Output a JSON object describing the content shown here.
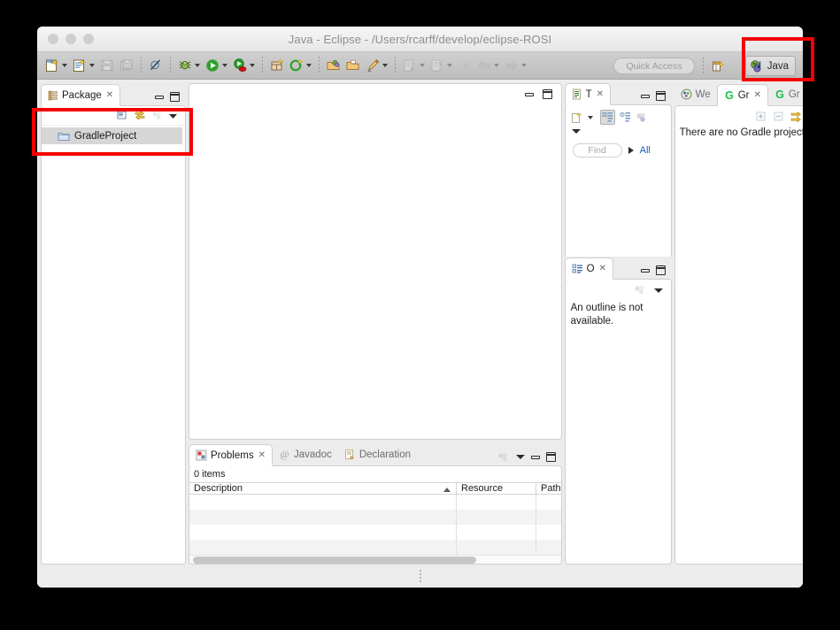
{
  "window": {
    "title": "Java - Eclipse - /Users/rcarff/develop/eclipse-ROSI",
    "traffic_lights": [
      "close",
      "minimize",
      "zoom"
    ]
  },
  "toolbar": {
    "items": [
      {
        "name": "new-wizard",
        "icon": "new-file-icon",
        "dropdown": true
      },
      {
        "name": "new-java-class",
        "icon": "new-class-icon",
        "dropdown": true
      },
      {
        "name": "save",
        "icon": "save-icon",
        "dropdown": false,
        "enabled": false
      },
      {
        "name": "save-all",
        "icon": "save-all-icon",
        "dropdown": false,
        "enabled": false
      },
      {
        "name": "skip-all-breakpoints",
        "icon": "breakpoint-skip-icon",
        "dropdown": false
      },
      {
        "name": "debug",
        "icon": "debug-bug-icon",
        "dropdown": true
      },
      {
        "name": "run",
        "icon": "run-green-play-icon",
        "dropdown": true
      },
      {
        "name": "external-tools",
        "icon": "external-tools-icon",
        "dropdown": true
      },
      {
        "name": "new-java-package",
        "icon": "new-package-icon",
        "dropdown": false
      },
      {
        "name": "new-annotation",
        "icon": "new-annotation-icon",
        "dropdown": true
      },
      {
        "name": "open-type",
        "icon": "open-type-icon",
        "dropdown": false
      },
      {
        "name": "open-task",
        "icon": "open-task-icon",
        "dropdown": false
      },
      {
        "name": "toggle-mark-occurrences",
        "icon": "highlighter-pen-icon",
        "dropdown": true
      },
      {
        "name": "next-annotation",
        "icon": "next-annotation-icon",
        "dropdown": true,
        "enabled": false
      },
      {
        "name": "previous-annotation",
        "icon": "previous-annotation-icon",
        "dropdown": true,
        "enabled": false
      },
      {
        "name": "last-edit-location",
        "icon": "last-edit-icon",
        "dropdown": false,
        "enabled": false
      },
      {
        "name": "back",
        "icon": "arrow-left-icon",
        "dropdown": true,
        "enabled": false
      },
      {
        "name": "forward",
        "icon": "arrow-right-icon",
        "dropdown": true,
        "enabled": false
      }
    ],
    "quick_access_placeholder": "Quick Access",
    "open_perspective_icon": "open-perspective-icon",
    "perspective_button": {
      "label": "Java",
      "icon": "java-perspective-icon"
    }
  },
  "package_explorer": {
    "tab": {
      "label": "Package",
      "icon": "package-explorer-icon",
      "close_glyph": "✕"
    },
    "view_actions": [
      {
        "name": "collapse-all",
        "icon": "collapse-all-icon"
      },
      {
        "name": "link-with-editor",
        "icon": "link-editor-icon"
      },
      {
        "name": "view-menu-dots",
        "icon": "view-menu-icon"
      },
      {
        "name": "view-menu-triangle",
        "icon": "chevron-down-icon"
      }
    ],
    "tab_actions": [
      {
        "name": "minimize",
        "icon": "minimize-icon"
      },
      {
        "name": "maximize",
        "icon": "maximize-icon"
      }
    ],
    "tree": [
      {
        "label": "GradleProject",
        "icon": "folder-icon",
        "selected": true
      }
    ]
  },
  "editor_area": {
    "actions": [
      {
        "name": "minimize",
        "icon": "minimize-icon"
      },
      {
        "name": "maximize",
        "icon": "maximize-icon"
      }
    ]
  },
  "task_list": {
    "tab": {
      "label": "T",
      "icon": "task-list-icon",
      "close_glyph": "✕"
    },
    "tab_actions": [
      {
        "name": "minimize",
        "icon": "minimize-icon"
      },
      {
        "name": "maximize",
        "icon": "maximize-icon"
      }
    ],
    "view_actions": [
      {
        "name": "new-task",
        "icon": "new-task-icon",
        "dropdown": true
      },
      {
        "name": "categorized-presentation",
        "icon": "categorized-icon",
        "active": true
      },
      {
        "name": "scheduled-presentation",
        "icon": "scheduled-icon"
      },
      {
        "name": "synchronize-changed",
        "icon": "synchronize-icon"
      },
      {
        "name": "view-menu",
        "icon": "chevron-down-icon"
      }
    ],
    "find_placeholder": "Find",
    "run_glyph": "▶",
    "all_label": "All"
  },
  "outline": {
    "tab": {
      "label": "O",
      "icon": "outline-icon",
      "close_glyph": "✕"
    },
    "tab_actions": [
      {
        "name": "minimize",
        "icon": "minimize-icon"
      },
      {
        "name": "maximize",
        "icon": "maximize-icon"
      }
    ],
    "view_actions": [
      {
        "name": "view-menu-dots",
        "icon": "view-menu-icon"
      },
      {
        "name": "view-menu",
        "icon": "chevron-down-icon"
      }
    ],
    "message": "An outline is not available."
  },
  "gradle": {
    "tabs": [
      {
        "label": "We",
        "icon": "welcome-icon",
        "active": false,
        "closable": false
      },
      {
        "label": "Gr",
        "icon": "gradle-g-icon",
        "active": true,
        "closable": true
      },
      {
        "label": "Gr",
        "icon": "gradle-g-icon",
        "active": false,
        "closable": false
      }
    ],
    "tab_actions": [
      {
        "name": "minimize",
        "icon": "minimize-icon"
      },
      {
        "name": "maximize",
        "icon": "maximize-icon"
      }
    ],
    "view_actions": [
      {
        "name": "expand-all",
        "icon": "expand-all-icon"
      },
      {
        "name": "collapse-all",
        "icon": "collapse-all-icon"
      },
      {
        "name": "link-with-selection",
        "icon": "link-selection-icon"
      },
      {
        "name": "refresh-tasks",
        "icon": "refresh-yellow-icon"
      },
      {
        "name": "refresh-all",
        "icon": "refresh-all-yellow-icon"
      },
      {
        "name": "view-menu",
        "icon": "chevron-down-icon"
      }
    ],
    "message": "There are no Gradle projects in the curr"
  },
  "problems": {
    "tabs": [
      {
        "label": "Problems",
        "icon": "problems-icon",
        "active": true,
        "closable": true
      },
      {
        "label": "Javadoc",
        "icon": "javadoc-at-icon",
        "active": false,
        "closable": false
      },
      {
        "label": "Declaration",
        "icon": "declaration-icon",
        "active": false,
        "closable": false
      }
    ],
    "view_actions": [
      {
        "name": "view-menu-dots",
        "icon": "view-menu-icon"
      },
      {
        "name": "view-menu",
        "icon": "chevron-down-icon"
      },
      {
        "name": "minimize",
        "icon": "minimize-icon"
      },
      {
        "name": "maximize",
        "icon": "maximize-icon"
      }
    ],
    "item_count_label": "0 items",
    "columns": [
      {
        "label": "Description",
        "sorted": true
      },
      {
        "label": "Resource",
        "sorted": false
      },
      {
        "label": "Path",
        "sorted": false
      }
    ],
    "rows": []
  },
  "status_bar": {
    "grip_icon": "resize-grip-icon"
  },
  "annotations": [
    {
      "name": "package-explorer-highlight",
      "color": "#f40000"
    },
    {
      "name": "java-perspective-highlight",
      "color": "#f40000"
    }
  ]
}
